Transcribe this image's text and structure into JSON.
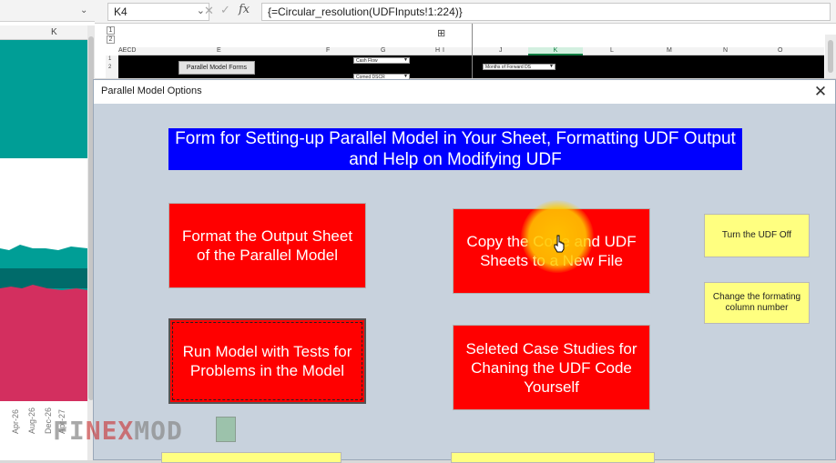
{
  "formula_bar": {
    "cell_ref": "K4",
    "formula": "{=Circular_resolution(UDFInputs!1:224)}"
  },
  "left_pane": {
    "col_label": "K",
    "dates": [
      "Apr-26",
      "Aug-26",
      "Dec-26",
      "Apr-27"
    ],
    "colors": {
      "teal": "#009e96",
      "crimson": "#d32f5f"
    }
  },
  "sheet": {
    "group_levels": [
      "1",
      "2"
    ],
    "row_numbers": [
      "1",
      "2"
    ],
    "columns": [
      "AECD",
      "E",
      "F",
      "G",
      "H",
      "I",
      "J",
      "K",
      "L",
      "M",
      "N",
      "O"
    ],
    "active_column": "K",
    "pm_forms_button": "Parallel Model Forms",
    "dropdowns": [
      "Cash Flow",
      "Comed DSCR",
      "Months of Forward DS"
    ]
  },
  "dialog": {
    "title": "Parallel Model Options",
    "header": "Form for Setting-up Parallel Model in Your Sheet, Formatting UDF Output and Help on Modifying UDF",
    "buttons": {
      "format_output": "Format the Output Sheet of the Parallel Model",
      "copy_code": "Copy the Code and UDF Sheets to a New File",
      "run_tests": "Run Model with Tests for Problems in the Model",
      "case_studies": "Seleted Case Studies for Chaning the UDF Code Yourself",
      "udf_off": "Turn the UDF Off",
      "change_column": "Change the formating column number"
    },
    "colors": {
      "header_bg": "#0000ff",
      "action_red": "#ff0000",
      "option_yellow": "#ffff80",
      "dialog_bg": "#c8d2dd"
    }
  },
  "watermark": {
    "part1": "FI",
    "part2": "N",
    "part3": "EX",
    "part4": "MOD"
  }
}
